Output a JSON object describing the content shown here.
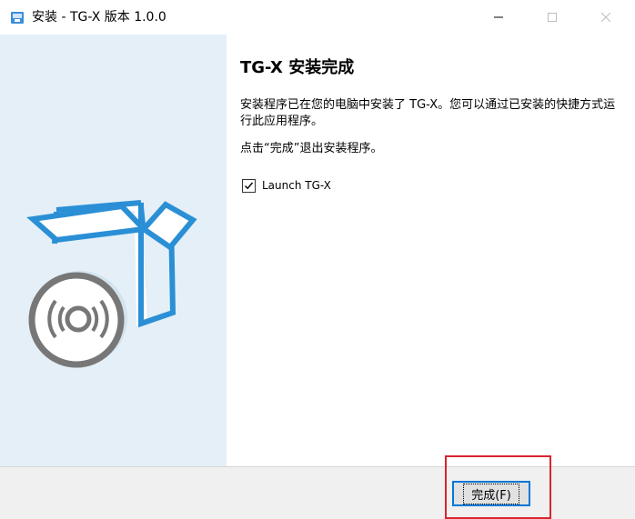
{
  "window": {
    "title": "安装 - TG-X 版本 1.0.0",
    "icon": "installer-icon",
    "controls": [
      "minimize",
      "maximize",
      "close"
    ]
  },
  "content": {
    "heading": "TG-X 安装完成",
    "paragraph1": "安装程序已在您的电脑中安装了 TG-X。您可以通过已安装的快捷方式运行此应用程序。",
    "paragraph2": "点击“完成”退出安装程序。",
    "launch_checkbox": {
      "label": "Launch TG-X",
      "checked": true
    }
  },
  "footer": {
    "finish_button": "完成(F)"
  },
  "colors": {
    "accent": "#0078d7",
    "left_panel_bg": "#e4eff7",
    "illustration_blue": "#2b8fd6",
    "disc_gray": "#777777",
    "highlight_red": "#d9242f",
    "footer_bg": "#f0f0f0"
  }
}
